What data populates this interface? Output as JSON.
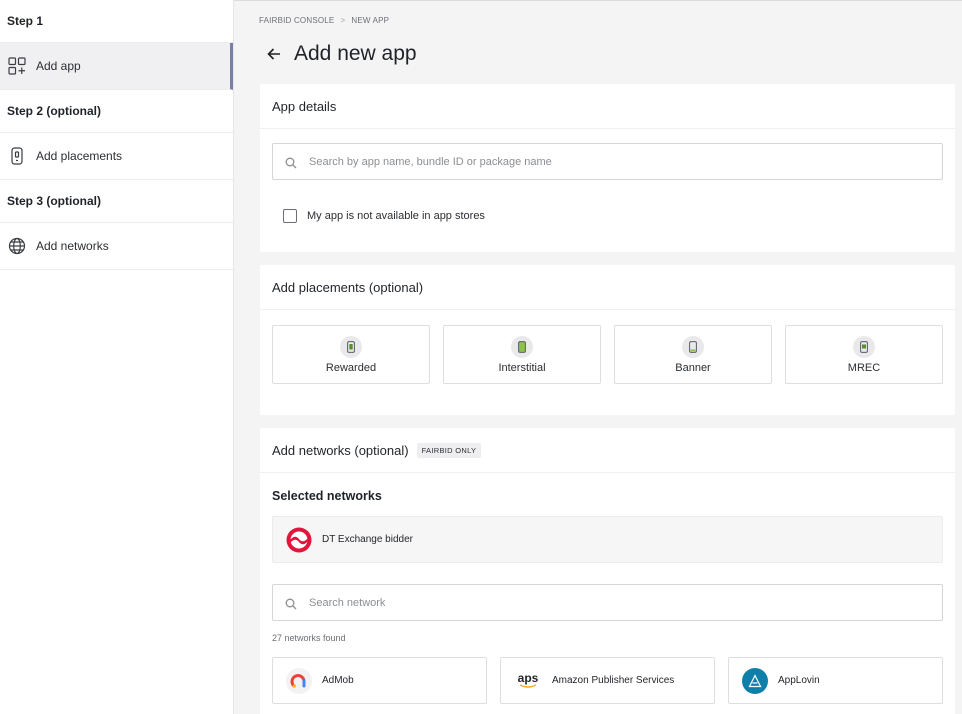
{
  "sidebar": {
    "steps": [
      {
        "heading": "Step 1",
        "item": "Add app",
        "icon": "apps-add-icon"
      },
      {
        "heading": "Step 2 (optional)",
        "item": "Add placements",
        "icon": "phone-icon"
      },
      {
        "heading": "Step 3 (optional)",
        "item": "Add networks",
        "icon": "globe-icon"
      }
    ]
  },
  "breadcrumb": {
    "root": "FAIRBID CONSOLE",
    "separator": ">",
    "current": "NEW APP"
  },
  "page": {
    "title": "Add new app"
  },
  "app_details": {
    "title": "App details",
    "search_placeholder": "Search by app name, bundle ID or package name",
    "checkbox_label": "My app is not available in app stores"
  },
  "placements": {
    "title": "Add placements (optional)",
    "items": [
      "Rewarded",
      "Interstitial",
      "Banner",
      "MREC"
    ]
  },
  "networks": {
    "title": "Add networks (optional)",
    "badge": "FAIRBID ONLY",
    "selected_title": "Selected networks",
    "selected": [
      {
        "name": "DT Exchange bidder",
        "color": "#e0173c"
      }
    ],
    "search_placeholder": "Search network",
    "count_text": "27 networks found",
    "list": [
      {
        "name": "AdMob"
      },
      {
        "name": "Amazon Publisher Services",
        "logo_text": "aps"
      },
      {
        "name": "AppLovin",
        "color": "#0e7fa8"
      }
    ]
  }
}
